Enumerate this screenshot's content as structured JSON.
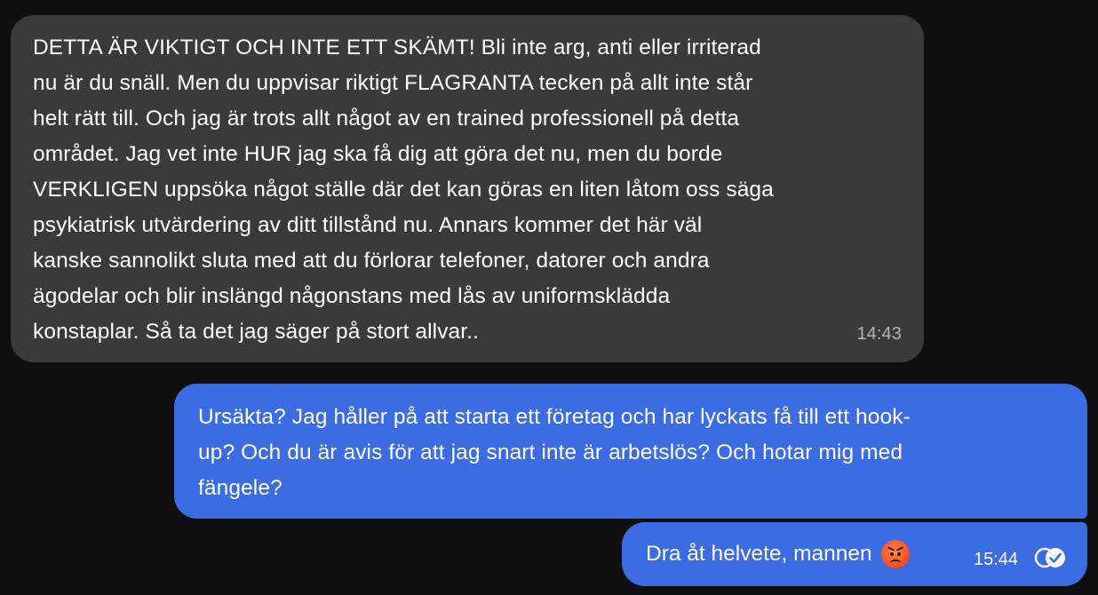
{
  "messages": {
    "incoming": {
      "text": "DETTA ÄR VIKTIGT OCH INTE ETT SKÄMT! Bli inte arg, anti eller irriterad\nnu är du snäll. Men du uppvisar riktigt FLAGRANTA tecken på allt inte står\nhelt rätt till. Och jag är trots allt något av en trained professionell på detta\nområdet. Jag vet inte HUR jag ska få dig att göra det nu, men du borde\nVERKLIGEN uppsöka något ställe där det kan göras en liten låtom oss säga\npsykiatrisk utvärdering av ditt tillstånd nu. Annars kommer det här väl\nkanske sannolikt sluta med att du förlorar telefoner, datorer och andra\nägodelar och blir inslängd någonstans med lås av uniformsklädda\nkonstaplar. Så ta det jag säger på stort allvar..",
      "time": "14:43"
    },
    "outgoing_1": {
      "text": "Ursäkta? Jag håller på att starta ett företag och har lyckats få till ett hook-\nup? Och du är avis för att jag snart inte är arbetslös? Och hotar mig med\nfängele?"
    },
    "outgoing_2": {
      "text": "Dra åt helvete, mannen",
      "emoji": "angry-face-emoji",
      "time": "15:44",
      "status_icon": "read-checkmark-icon"
    }
  },
  "colors": {
    "background": "#0f0f0f",
    "incoming_bubble": "#3a3a3a",
    "outgoing_bubble": "#3b6ce2",
    "incoming_time": "#b5b5b5"
  }
}
